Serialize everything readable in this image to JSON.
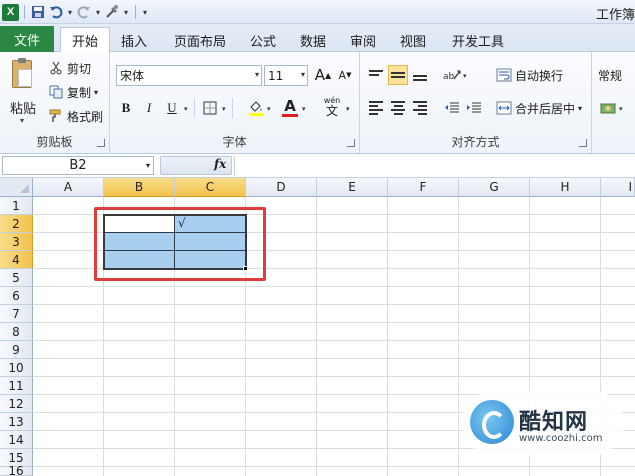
{
  "app": {
    "window_title": "工作簿"
  },
  "quick_access": {
    "app_icon": "excel-logo",
    "logo_text": "X",
    "save_icon": "save-icon",
    "undo_icon": "undo-icon",
    "redo_icon": "redo-icon",
    "custom_icon": "customize-icon"
  },
  "tabs": [
    {
      "label": "文件"
    },
    {
      "label": "开始"
    },
    {
      "label": "插入"
    },
    {
      "label": "页面布局"
    },
    {
      "label": "公式"
    },
    {
      "label": "数据"
    },
    {
      "label": "审阅"
    },
    {
      "label": "视图"
    },
    {
      "label": "开发工具"
    }
  ],
  "clipboard": {
    "paste_label": "粘贴",
    "cut_label": "剪切",
    "copy_label": "复制",
    "format_painter_label": "格式刷",
    "group_label": "剪贴板"
  },
  "font": {
    "font_name": "宋体",
    "font_size": "11",
    "grow_label": "A",
    "shrink_label": "A",
    "bold": "B",
    "italic": "I",
    "underline": "U",
    "font_color_label": "A",
    "phonetic_label": "wén",
    "group_label": "字体"
  },
  "alignment": {
    "wrap_text_label": "自动换行",
    "merge_center_label": "合并后居中",
    "group_label": "对齐方式"
  },
  "number": {
    "format_value": "常规"
  },
  "formula_bar": {
    "name_box": "B2",
    "fx_label": "fx",
    "formula": ""
  },
  "grid": {
    "columns": [
      "A",
      "B",
      "C",
      "D",
      "E",
      "F",
      "G",
      "H",
      "I"
    ],
    "rows": [
      "1",
      "2",
      "3",
      "4",
      "5",
      "6",
      "7",
      "8",
      "9",
      "10",
      "11",
      "12",
      "13",
      "14",
      "15",
      "16"
    ],
    "selected_columns": [
      "B",
      "C"
    ],
    "selected_rows": [
      "2",
      "3",
      "4"
    ],
    "active_cell": "B2",
    "selection_range": "B2:C4",
    "c2_mark": "√"
  },
  "colors": {
    "file_tab": "#2a8744",
    "selection_fill": "#a8cff0",
    "header_selected": "#f1c24c",
    "highlight_box": "#e23b3b"
  },
  "watermark": {
    "title": "酷知网",
    "url": "www.coozhi.com"
  }
}
